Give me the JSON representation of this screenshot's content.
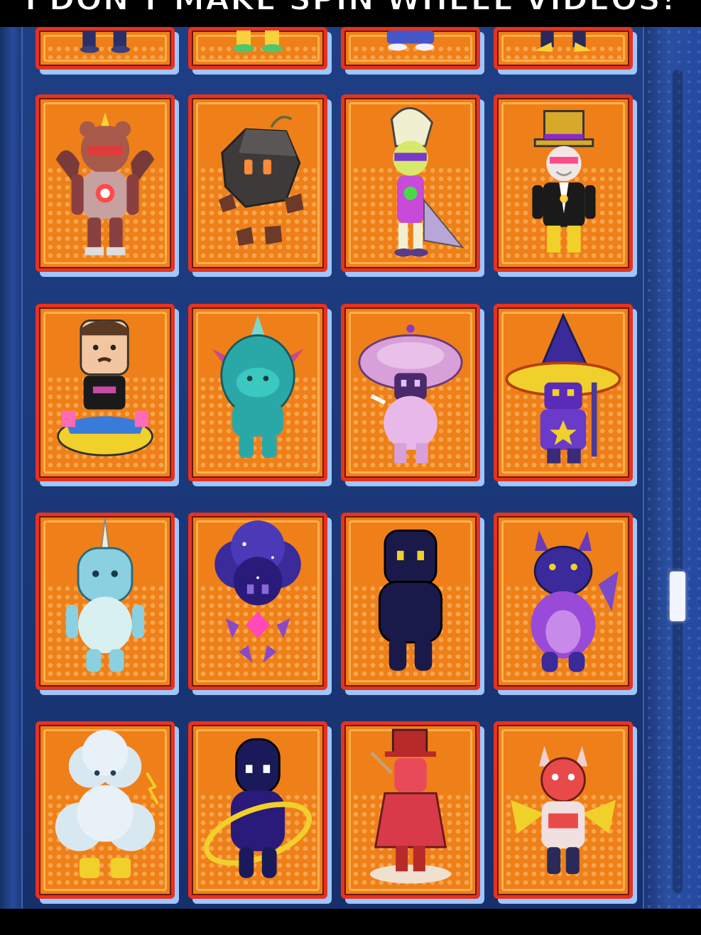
{
  "caption": "I DON'T MAKE SPIN WHEEL VIDEOS!",
  "colors": {
    "background": "#1f3f85",
    "card_fill": "#ef7f19",
    "card_border": "#e8321d",
    "scrollbar_thumb": "#f2f4ff"
  },
  "skins": [
    {
      "name": "partial-skin-1",
      "icon": "partial-skin-icon"
    },
    {
      "name": "partial-skin-2",
      "icon": "partial-skin-icon"
    },
    {
      "name": "partial-skin-3",
      "icon": "partial-skin-icon"
    },
    {
      "name": "partial-skin-4",
      "icon": "partial-skin-icon"
    },
    {
      "name": "robot-bear-skin",
      "icon": "robot-bear-icon"
    },
    {
      "name": "rock-golem-skin",
      "icon": "rock-golem-icon"
    },
    {
      "name": "jester-clown-skin",
      "icon": "jester-icon"
    },
    {
      "name": "top-hat-gentleman-skin",
      "icon": "top-hat-icon"
    },
    {
      "name": "beast-youtuber-skin",
      "icon": "youtuber-icon"
    },
    {
      "name": "teal-dragon-skin",
      "icon": "teal-dragon-icon"
    },
    {
      "name": "mushroom-skin",
      "icon": "mushroom-icon"
    },
    {
      "name": "wizard-skin",
      "icon": "wizard-hat-icon"
    },
    {
      "name": "narwhal-skin",
      "icon": "narwhal-icon"
    },
    {
      "name": "galaxy-tree-skin",
      "icon": "galaxy-tree-icon"
    },
    {
      "name": "shadow-skin",
      "icon": "shadow-icon"
    },
    {
      "name": "purple-dragon-skin",
      "icon": "purple-dragon-icon"
    },
    {
      "name": "storm-cloud-skin",
      "icon": "cloud-icon"
    },
    {
      "name": "cosmic-ring-skin",
      "icon": "cosmic-ring-icon"
    },
    {
      "name": "red-samurai-skin",
      "icon": "samurai-icon"
    },
    {
      "name": "fire-demon-skin",
      "icon": "fire-demon-icon"
    }
  ]
}
